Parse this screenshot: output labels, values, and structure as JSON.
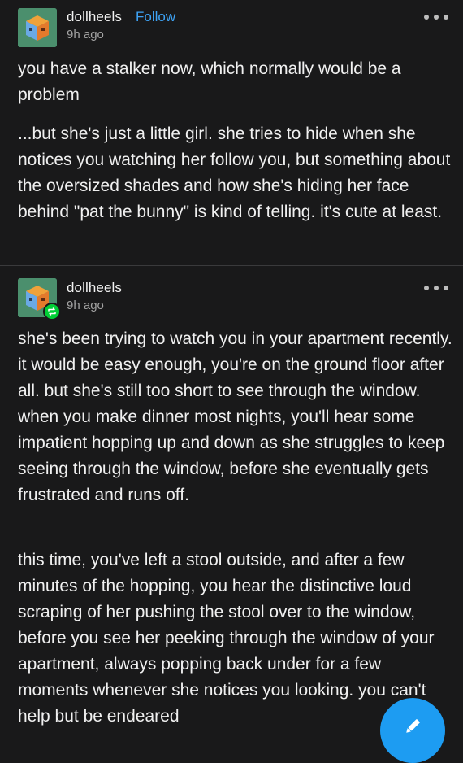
{
  "posts": [
    {
      "username": "dollheels",
      "follow_label": "Follow",
      "time": "9h ago",
      "avatar_icon": "cube-avatar-icon",
      "paragraphs": [
        "you have a stalker now, which normally would be a problem",
        "...but she's just a little girl. she tries to hide when she notices you watching her follow you, but something about the oversized shades and how she's hiding her face behind \"pat the bunny\" is kind of telling. it's cute at least."
      ]
    },
    {
      "username": "dollheels",
      "time": "9h ago",
      "avatar_icon": "cube-avatar-icon",
      "badge_icon": "reblog-icon",
      "paragraphs": [
        "she's been trying to watch you in your apartment recently. it would be easy enough, you're on the ground floor after all. but she's still too short to see through the window. when you make dinner most nights, you'll hear some impatient hopping up and down as she struggles to keep seeing through the window, before she eventually gets frustrated and runs off.",
        "this time, you've left a stool outside, and after a few minutes of the hopping, you hear the distinctive loud scraping of her pushing the stool over to the window, before you see her peeking through the window of your apartment, always popping back under for a few moments whenever she notices you looking. you can't help but be endeared"
      ]
    }
  ],
  "fab": {
    "icon": "pencil-icon"
  },
  "colors": {
    "background": "#19191a",
    "link": "#3ea3f5",
    "fab": "#1d9cf2",
    "reblog": "#00cf35"
  }
}
